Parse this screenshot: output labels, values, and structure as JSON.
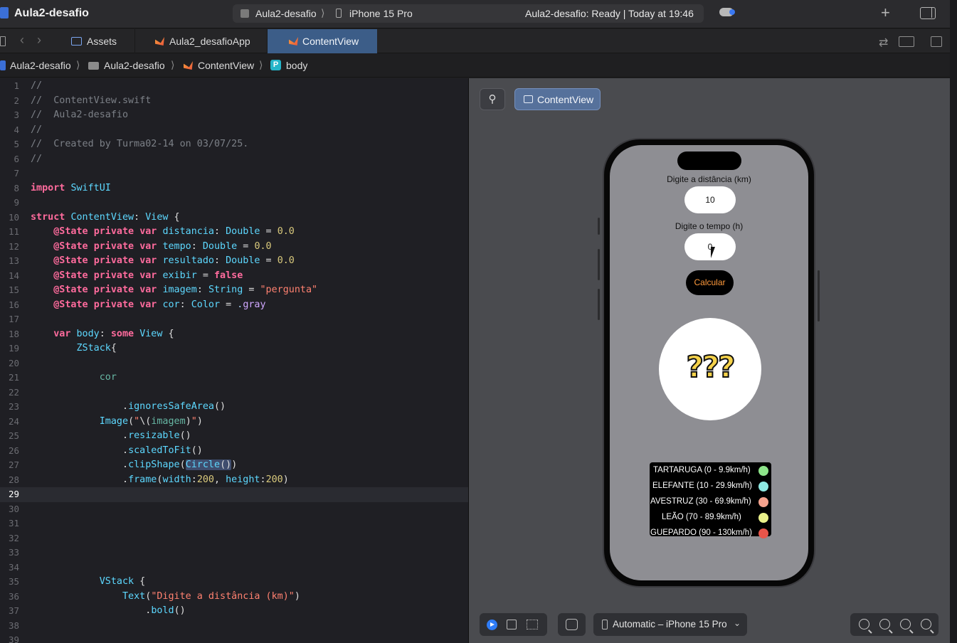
{
  "window": {
    "project_title": "Aula2-desafio",
    "scheme_target": "Aula2-desafio",
    "scheme_separator": "⟩",
    "scheme_device": "iPhone 15 Pro",
    "status": "Aula2-desafio: Ready | Today at 19:46"
  },
  "tabs": [
    {
      "label": "Assets",
      "icon": "asset-catalog-icon"
    },
    {
      "label": "Aula2_desafioApp",
      "icon": "swift-file-icon"
    },
    {
      "label": "ContentView",
      "icon": "swift-file-icon",
      "active": true
    }
  ],
  "jumpbar": {
    "project": "Aula2-desafio",
    "folder": "Aula2-desafio",
    "file": "ContentView",
    "symbol_badge": "P",
    "symbol": "body",
    "separator": "⟩"
  },
  "editor": {
    "current_line": 29,
    "lines": [
      {
        "n": "1",
        "text": "//"
      },
      {
        "n": "2",
        "text": "//  ContentView.swift"
      },
      {
        "n": "3",
        "text": "//  Aula2-desafio"
      },
      {
        "n": "4",
        "text": "//"
      },
      {
        "n": "5",
        "text": "//  Created by Turma02-14 on 03/07/25."
      },
      {
        "n": "6",
        "text": "//"
      },
      {
        "n": "7",
        "text": ""
      },
      {
        "n": "8",
        "text": "import SwiftUI"
      },
      {
        "n": "9",
        "text": ""
      },
      {
        "n": "10",
        "text": "struct ContentView: View {"
      },
      {
        "n": "11",
        "text": "    @State private var distancia: Double = 0.0"
      },
      {
        "n": "12",
        "text": "    @State private var tempo: Double = 0.0"
      },
      {
        "n": "13",
        "text": "    @State private var resultado: Double = 0.0"
      },
      {
        "n": "14",
        "text": "    @State private var exibir = false"
      },
      {
        "n": "15",
        "text": "    @State private var imagem: String = \"pergunta\""
      },
      {
        "n": "16",
        "text": "    @State private var cor: Color = .gray"
      },
      {
        "n": "17",
        "text": ""
      },
      {
        "n": "18",
        "text": "    var body: some View {"
      },
      {
        "n": "19",
        "text": "        ZStack{"
      },
      {
        "n": "20",
        "text": ""
      },
      {
        "n": "21",
        "text": "            cor"
      },
      {
        "n": "22",
        "text": ""
      },
      {
        "n": "23",
        "text": "                .ignoresSafeArea()"
      },
      {
        "n": "24",
        "text": "            Image(\"\\(imagem)\")"
      },
      {
        "n": "25",
        "text": "                .resizable()"
      },
      {
        "n": "26",
        "text": "                .scaledToFit()"
      },
      {
        "n": "27",
        "text": "                .clipShape(Circle())"
      },
      {
        "n": "28",
        "text": "                .frame(width:200, height:200)"
      },
      {
        "n": "29",
        "text": ""
      },
      {
        "n": "30",
        "text": ""
      },
      {
        "n": "31",
        "text": ""
      },
      {
        "n": "32",
        "text": ""
      },
      {
        "n": "33",
        "text": ""
      },
      {
        "n": "34",
        "text": ""
      },
      {
        "n": "35",
        "text": "            VStack {"
      },
      {
        "n": "36",
        "text": "                Text(\"Digite a distância (km)\")"
      },
      {
        "n": "37",
        "text": "                    .bold()"
      },
      {
        "n": "38",
        "text": ""
      },
      {
        "n": "39",
        "text": ""
      }
    ]
  },
  "canvas": {
    "pin_icon": "pin-icon",
    "preview_chip": "ContentView",
    "device_selector": "Automatic – iPhone 15 Pro",
    "app": {
      "distance_label": "Digite a distância (km)",
      "distance_value": "10",
      "time_label": "Digite o tempo (h)",
      "time_value": "0",
      "calc_button": "Calcular",
      "image_placeholder": "???",
      "legend": [
        {
          "text": "TARTARUGA (0 - 9.9km/h)",
          "color": "#8ee48a"
        },
        {
          "text": "ELEFANTE (10 - 29.9km/h)",
          "color": "#8ee8e2"
        },
        {
          "text": "AVESTRUZ (30 - 69.9km/h)",
          "color": "#f5a38e"
        },
        {
          "text": "LEÃO (70 - 89.9km/h)",
          "color": "#e9f08a"
        },
        {
          "text": "GUEPARDO (90 - 130km/h)",
          "color": "#e8554a"
        }
      ]
    }
  },
  "colors": {
    "active_tab": "#3c5d88",
    "keyword": "#ff6b9d",
    "type": "#5dd8ff",
    "number": "#d9c97c",
    "string": "#ff8170",
    "calc_text": "#ff9a3c"
  }
}
